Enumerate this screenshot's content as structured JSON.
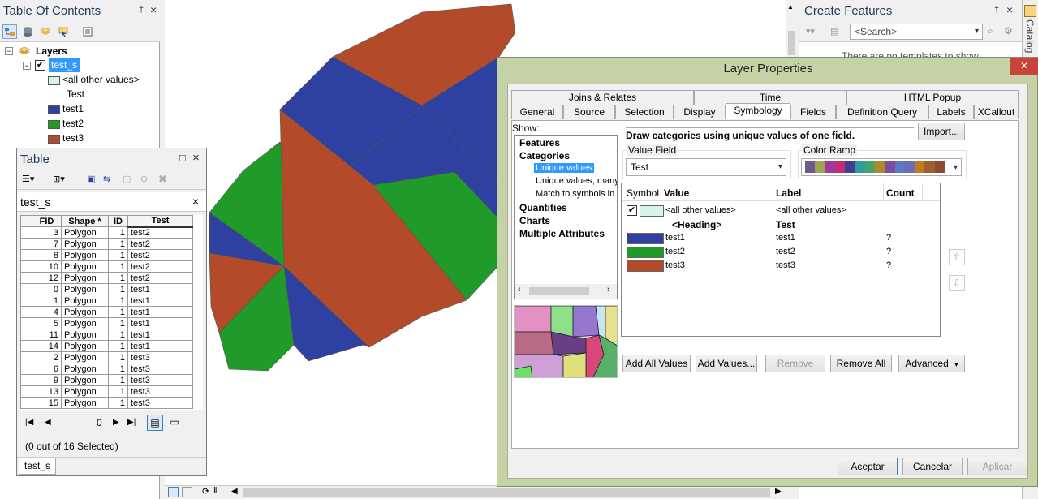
{
  "toc": {
    "title": "Table Of Contents",
    "pin": "†",
    "close": "×",
    "layers_label": "Layers",
    "layer_name": "test_s",
    "expand_minus": "−",
    "other_values": "<all other values>",
    "heading": "Test",
    "items": [
      {
        "label": "test1",
        "color": "#2e40a0"
      },
      {
        "label": "test2",
        "color": "#209a28"
      },
      {
        "label": "test3",
        "color": "#b34b2b"
      }
    ],
    "other_color": "#d4f4ec"
  },
  "table": {
    "title": "Table",
    "maximize": "□",
    "close": "×",
    "tab_title": "test_s",
    "columns": [
      "FID",
      "Shape *",
      "ID",
      "Test"
    ],
    "rows": [
      [
        "3",
        "Polygon",
        "1",
        "test2"
      ],
      [
        "7",
        "Polygon",
        "1",
        "test2"
      ],
      [
        "8",
        "Polygon",
        "1",
        "test2"
      ],
      [
        "10",
        "Polygon",
        "1",
        "test2"
      ],
      [
        "12",
        "Polygon",
        "1",
        "test2"
      ],
      [
        "0",
        "Polygon",
        "1",
        "test1"
      ],
      [
        "1",
        "Polygon",
        "1",
        "test1"
      ],
      [
        "4",
        "Polygon",
        "1",
        "test1"
      ],
      [
        "5",
        "Polygon",
        "1",
        "test1"
      ],
      [
        "11",
        "Polygon",
        "1",
        "test1"
      ],
      [
        "14",
        "Polygon",
        "1",
        "test1"
      ],
      [
        "2",
        "Polygon",
        "1",
        "test3"
      ],
      [
        "6",
        "Polygon",
        "1",
        "test3"
      ],
      [
        "9",
        "Polygon",
        "1",
        "test3"
      ],
      [
        "13",
        "Polygon",
        "1",
        "test3"
      ],
      [
        "15",
        "Polygon",
        "1",
        "test3"
      ]
    ],
    "record_value": "0",
    "selection_status": "(0 out of 16 Selected)",
    "bottom_tab": "test_s"
  },
  "create_features": {
    "title": "Create Features",
    "search_placeholder": "<Search>",
    "empty_text": "There are no templates to show",
    "catalog_tab": "Catalog"
  },
  "dialog": {
    "title": "Layer Properties",
    "close": "✕",
    "tabs_row1": [
      "Joins & Relates",
      "Time",
      "HTML Popup"
    ],
    "tabs_row2": [
      "General",
      "Source",
      "Selection",
      "Display",
      "Symbology",
      "Fields",
      "Definition Query",
      "Labels",
      "XCallout"
    ],
    "selected_tab": "Symbology",
    "show_label": "Show:",
    "show_tree": {
      "features": "Features",
      "categories": "Categories",
      "cat_items": [
        "Unique values",
        "Unique values, many",
        "Match to symbols in a"
      ],
      "quantities": "Quantities",
      "charts": "Charts",
      "multiple": "Multiple Attributes"
    },
    "description": "Draw categories using unique values of one field.",
    "import_btn": "Import...",
    "value_field_label": "Value Field",
    "value_field": "Test",
    "color_ramp_label": "Color Ramp",
    "ramp_colors": [
      "#6b5b8b",
      "#9ea54e",
      "#a0399c",
      "#c02e70",
      "#3e3e8c",
      "#2f9da0",
      "#4aa26b",
      "#b0892a",
      "#7b4e9f",
      "#5a7ac8",
      "#6f6db2",
      "#c07a24",
      "#a15d2c",
      "#8e4b2f"
    ],
    "grid_headers": [
      "Symbol",
      "Value",
      "Label",
      "Count"
    ],
    "grid_rows": [
      {
        "value": "<all other values>",
        "label": "<all other values>",
        "count": "",
        "color": "#d4f4ec",
        "check": "✔"
      },
      {
        "value": "<Heading>",
        "label": "Test",
        "count": "",
        "heading": true
      },
      {
        "value": "test1",
        "label": "test1",
        "count": "?",
        "color": "#2e40a0"
      },
      {
        "value": "test2",
        "label": "test2",
        "count": "?",
        "color": "#209a28"
      },
      {
        "value": "test3",
        "label": "test3",
        "count": "?",
        "color": "#b34b2b"
      }
    ],
    "buttons": {
      "add_all": "Add All Values",
      "add_values": "Add Values...",
      "remove": "Remove",
      "remove_all": "Remove All",
      "advanced": "Advanced"
    },
    "footer": {
      "ok": "Aceptar",
      "cancel": "Cancelar",
      "apply": "Aplicar"
    }
  },
  "map_status": {
    "page_size": "0"
  }
}
